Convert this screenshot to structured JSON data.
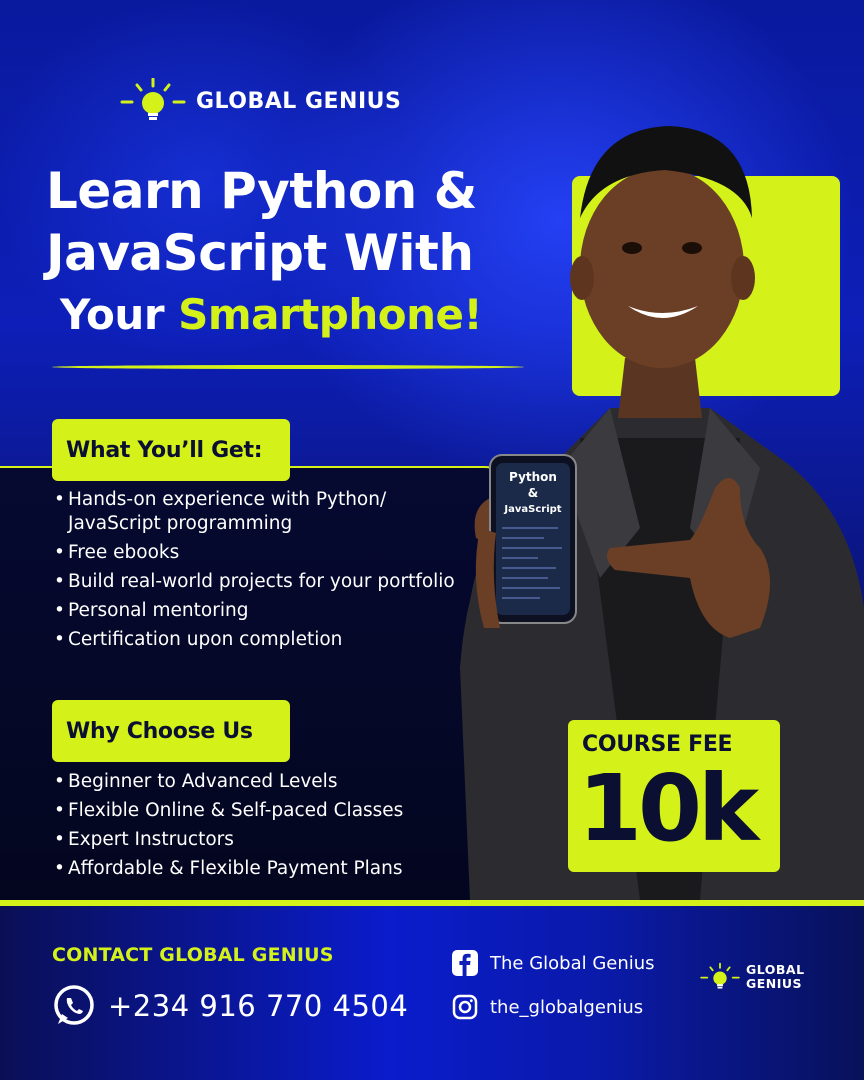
{
  "brand": {
    "name": "GLOBAL GENIUS",
    "footer_name_line1": "GLOBAL",
    "footer_name_line2": "GENIUS"
  },
  "headline": {
    "line1": "Learn Python &",
    "line2": "JavaScript With",
    "line3_prefix": "Your ",
    "line3_accent": "Smartphone!"
  },
  "what_you_get": {
    "title": "What You’ll Get:",
    "items": [
      "Hands-on experience with Python/ JavaScript programming",
      "Free ebooks",
      "Build real-world projects for your portfolio",
      "Personal mentoring",
      "Certification upon completion"
    ]
  },
  "why_choose_us": {
    "title": "Why Choose Us",
    "items": [
      "Beginner to Advanced Levels",
      "Flexible Online & Self-paced Classes",
      "Expert Instructors",
      "Affordable & Flexible Payment Plans"
    ]
  },
  "phone_screen": {
    "line1": "Python",
    "line2": "&",
    "line3": "JavaScript"
  },
  "course_fee": {
    "label": "COURSE FEE",
    "value": "10k"
  },
  "contact": {
    "title": "CONTACT GLOBAL GENIUS",
    "phone": "+234 916 770 4504",
    "facebook": "The Global Genius",
    "instagram": "the_globalgenius"
  },
  "colors": {
    "accent": "#d4f21a",
    "navy": "#0b1033",
    "blue": "#0d1fb8"
  },
  "icons": [
    "lightbulb-icon",
    "whatsapp-icon",
    "facebook-icon",
    "instagram-icon"
  ]
}
